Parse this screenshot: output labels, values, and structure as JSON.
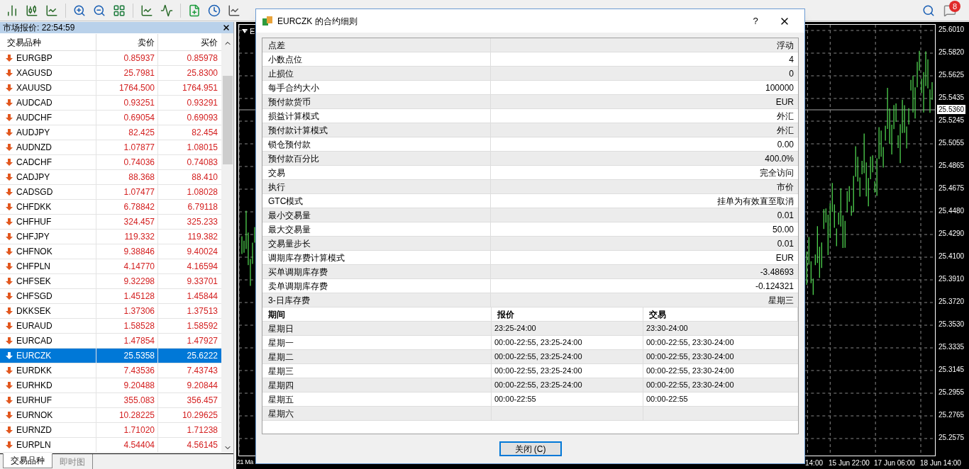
{
  "toolbar": {
    "notification_count": "8"
  },
  "market_watch": {
    "title": "市场报价: 22:54:59",
    "columns": [
      "交易品种",
      "卖价",
      "买价"
    ],
    "rows": [
      {
        "symbol": "EURGBP",
        "bid": "0.85937",
        "ask": "0.85978",
        "selected": false
      },
      {
        "symbol": "XAGUSD",
        "bid": "25.7981",
        "ask": "25.8300",
        "selected": false
      },
      {
        "symbol": "XAUUSD",
        "bid": "1764.500",
        "ask": "1764.951",
        "selected": false
      },
      {
        "symbol": "AUDCAD",
        "bid": "0.93251",
        "ask": "0.93291",
        "selected": false
      },
      {
        "symbol": "AUDCHF",
        "bid": "0.69054",
        "ask": "0.69093",
        "selected": false
      },
      {
        "symbol": "AUDJPY",
        "bid": "82.425",
        "ask": "82.454",
        "selected": false
      },
      {
        "symbol": "AUDNZD",
        "bid": "1.07877",
        "ask": "1.08015",
        "selected": false
      },
      {
        "symbol": "CADCHF",
        "bid": "0.74036",
        "ask": "0.74083",
        "selected": false
      },
      {
        "symbol": "CADJPY",
        "bid": "88.368",
        "ask": "88.410",
        "selected": false
      },
      {
        "symbol": "CADSGD",
        "bid": "1.07477",
        "ask": "1.08028",
        "selected": false
      },
      {
        "symbol": "CHFDKK",
        "bid": "6.78842",
        "ask": "6.79118",
        "selected": false
      },
      {
        "symbol": "CHFHUF",
        "bid": "324.457",
        "ask": "325.233",
        "selected": false
      },
      {
        "symbol": "CHFJPY",
        "bid": "119.332",
        "ask": "119.382",
        "selected": false
      },
      {
        "symbol": "CHFNOK",
        "bid": "9.38846",
        "ask": "9.40024",
        "selected": false
      },
      {
        "symbol": "CHFPLN",
        "bid": "4.14770",
        "ask": "4.16594",
        "selected": false
      },
      {
        "symbol": "CHFSEK",
        "bid": "9.32298",
        "ask": "9.33701",
        "selected": false
      },
      {
        "symbol": "CHFSGD",
        "bid": "1.45128",
        "ask": "1.45844",
        "selected": false
      },
      {
        "symbol": "DKKSEK",
        "bid": "1.37306",
        "ask": "1.37513",
        "selected": false
      },
      {
        "symbol": "EURAUD",
        "bid": "1.58528",
        "ask": "1.58592",
        "selected": false
      },
      {
        "symbol": "EURCAD",
        "bid": "1.47854",
        "ask": "1.47927",
        "selected": false
      },
      {
        "symbol": "EURCZK",
        "bid": "25.5358",
        "ask": "25.6222",
        "selected": true
      },
      {
        "symbol": "EURDKK",
        "bid": "7.43536",
        "ask": "7.43743",
        "selected": false
      },
      {
        "symbol": "EURHKD",
        "bid": "9.20488",
        "ask": "9.20844",
        "selected": false
      },
      {
        "symbol": "EURHUF",
        "bid": "355.083",
        "ask": "356.457",
        "selected": false
      },
      {
        "symbol": "EURNOK",
        "bid": "10.28225",
        "ask": "10.29625",
        "selected": false
      },
      {
        "symbol": "EURNZD",
        "bid": "1.71020",
        "ask": "1.71238",
        "selected": false
      },
      {
        "symbol": "EURPLN",
        "bid": "4.54404",
        "ask": "4.56145",
        "selected": false
      }
    ],
    "tabs": [
      {
        "label": "交易品种",
        "selected": true
      },
      {
        "label": "即时图",
        "selected": false
      }
    ]
  },
  "chart": {
    "title": "E",
    "price_labels": [
      "25.6010",
      "25.5820",
      "25.5625",
      "25.5435",
      "25.5245",
      "25.5055",
      "25.4865",
      "25.4675",
      "25.4480",
      "25.4290",
      "25.4100",
      "25.3910",
      "25.3720",
      "25.3530",
      "25.3335",
      "25.3145",
      "25.2955",
      "25.2765",
      "25.2575"
    ],
    "current_price": "25.5360",
    "time_labels": [
      "21 Ma",
      "14:00",
      "15 Jun 22:00",
      "17 Jun 06:00",
      "18 Jun 14:00"
    ]
  },
  "dialog": {
    "title": "EURCZK 的合约细则",
    "help": "?",
    "specs": [
      {
        "label": "点差",
        "value": "浮动"
      },
      {
        "label": "小数点位",
        "value": "4"
      },
      {
        "label": "止损位",
        "value": "0"
      },
      {
        "label": "每手合约大小",
        "value": "100000"
      },
      {
        "label": "预付款货币",
        "value": "EUR"
      },
      {
        "label": "损益计算模式",
        "value": "外汇"
      },
      {
        "label": "预付款计算模式",
        "value": "外汇"
      },
      {
        "label": "锁仓预付款",
        "value": "0.00"
      },
      {
        "label": "预付款百分比",
        "value": "400.0%"
      },
      {
        "label": "交易",
        "value": "完全访问"
      },
      {
        "label": "执行",
        "value": "市价"
      },
      {
        "label": "GTC模式",
        "value": "挂单为有效直至取消"
      },
      {
        "label": "最小交易量",
        "value": "0.01"
      },
      {
        "label": "最大交易量",
        "value": "50.00"
      },
      {
        "label": "交易量步长",
        "value": "0.01"
      },
      {
        "label": "调期库存费计算模式",
        "value": "EUR"
      },
      {
        "label": "买单调期库存费",
        "value": "-3.48693"
      },
      {
        "label": "卖单调期库存费",
        "value": "-0.124321"
      },
      {
        "label": "3-日库存费",
        "value": "星期三"
      }
    ],
    "sessions": {
      "columns": [
        "期间",
        "报价",
        "交易"
      ],
      "rows": [
        {
          "day": "星期日",
          "quotes": "23:25-24:00",
          "trade": "23:30-24:00"
        },
        {
          "day": "星期一",
          "quotes": "00:00-22:55, 23:25-24:00",
          "trade": "00:00-22:55, 23:30-24:00"
        },
        {
          "day": "星期二",
          "quotes": "00:00-22:55, 23:25-24:00",
          "trade": "00:00-22:55, 23:30-24:00"
        },
        {
          "day": "星期三",
          "quotes": "00:00-22:55, 23:25-24:00",
          "trade": "00:00-22:55, 23:30-24:00"
        },
        {
          "day": "星期四",
          "quotes": "00:00-22:55, 23:25-24:00",
          "trade": "00:00-22:55, 23:30-24:00"
        },
        {
          "day": "星期五",
          "quotes": "00:00-22:55",
          "trade": "00:00-22:55"
        },
        {
          "day": "星期六"
        }
      ]
    },
    "close_button": "关闭 (C)"
  }
}
